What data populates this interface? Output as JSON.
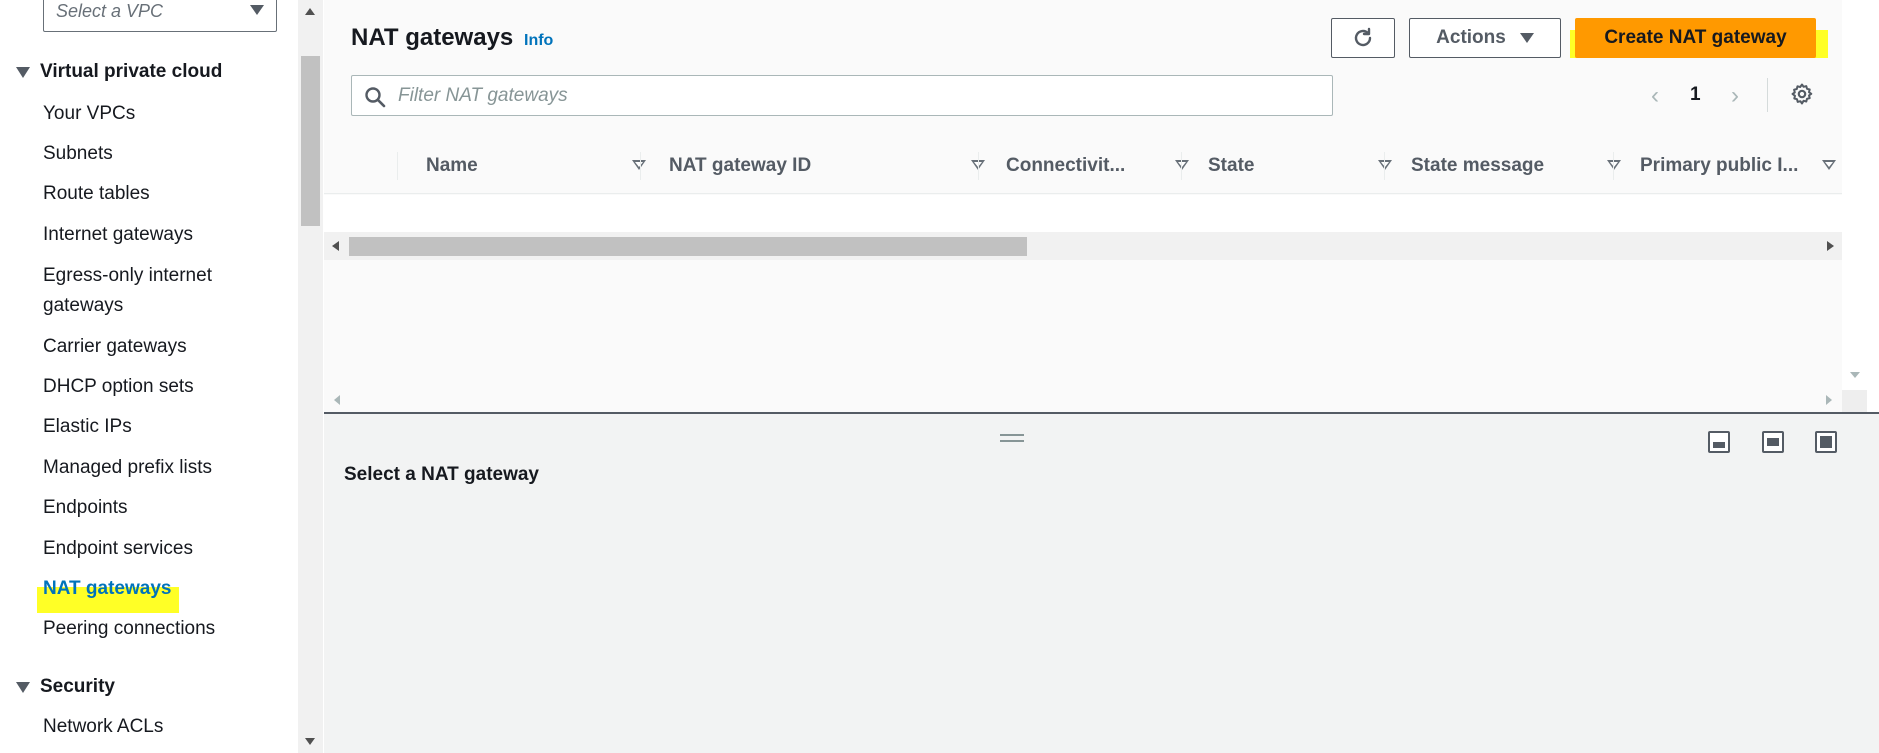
{
  "sidebar": {
    "vpc_select_placeholder": "Select a VPC",
    "section_vpc": "Virtual private cloud",
    "items": [
      {
        "label": "Your VPCs"
      },
      {
        "label": "Subnets"
      },
      {
        "label": "Route tables"
      },
      {
        "label": "Internet gateways"
      },
      {
        "label": "Egress-only internet gateways"
      },
      {
        "label": "Carrier gateways"
      },
      {
        "label": "DHCP option sets"
      },
      {
        "label": "Elastic IPs"
      },
      {
        "label": "Managed prefix lists"
      },
      {
        "label": "Endpoints"
      },
      {
        "label": "Endpoint services"
      },
      {
        "label": "NAT gateways",
        "active": true
      },
      {
        "label": "Peering connections"
      }
    ],
    "section_security": "Security",
    "security_items": [
      {
        "label": "Network ACLs"
      }
    ]
  },
  "header": {
    "title": "NAT gateways",
    "info": "Info",
    "refresh_icon": "refresh-icon",
    "actions_label": "Actions",
    "create_label": "Create NAT gateway",
    "accent_color": "#ff9900",
    "highlight_color": "#ffff00"
  },
  "search": {
    "placeholder": "Filter NAT gateways"
  },
  "pagination": {
    "current_page": "1"
  },
  "table": {
    "columns": [
      "Name",
      "NAT gateway ID",
      "Connectivit...",
      "State",
      "State message",
      "Primary public I..."
    ],
    "rows": []
  },
  "split_panel": {
    "title": "Select a NAT gateway"
  }
}
